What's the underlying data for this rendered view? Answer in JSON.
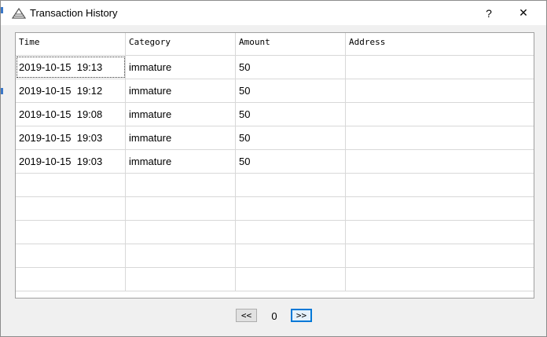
{
  "window": {
    "title": "Transaction History",
    "help_label": "?",
    "close_label": "✕"
  },
  "table": {
    "columns": [
      "Time",
      "Category",
      "Amount",
      "Address"
    ],
    "rows": [
      {
        "time": "2019-10-15  19:13",
        "category": "immature",
        "amount": "50",
        "address": ""
      },
      {
        "time": "2019-10-15  19:12",
        "category": "immature",
        "amount": "50",
        "address": ""
      },
      {
        "time": "2019-10-15  19:08",
        "category": "immature",
        "amount": "50",
        "address": ""
      },
      {
        "time": "2019-10-15  19:03",
        "category": "immature",
        "amount": "50",
        "address": ""
      },
      {
        "time": "2019-10-15  19:03",
        "category": "immature",
        "amount": "50",
        "address": ""
      },
      {
        "time": "",
        "category": "",
        "amount": "",
        "address": ""
      },
      {
        "time": "",
        "category": "",
        "amount": "",
        "address": ""
      },
      {
        "time": "",
        "category": "",
        "amount": "",
        "address": ""
      },
      {
        "time": "",
        "category": "",
        "amount": "",
        "address": ""
      },
      {
        "time": "",
        "category": "",
        "amount": "",
        "address": ""
      }
    ]
  },
  "pager": {
    "prev_label": "<<",
    "page": "0",
    "next_label": ">>"
  }
}
